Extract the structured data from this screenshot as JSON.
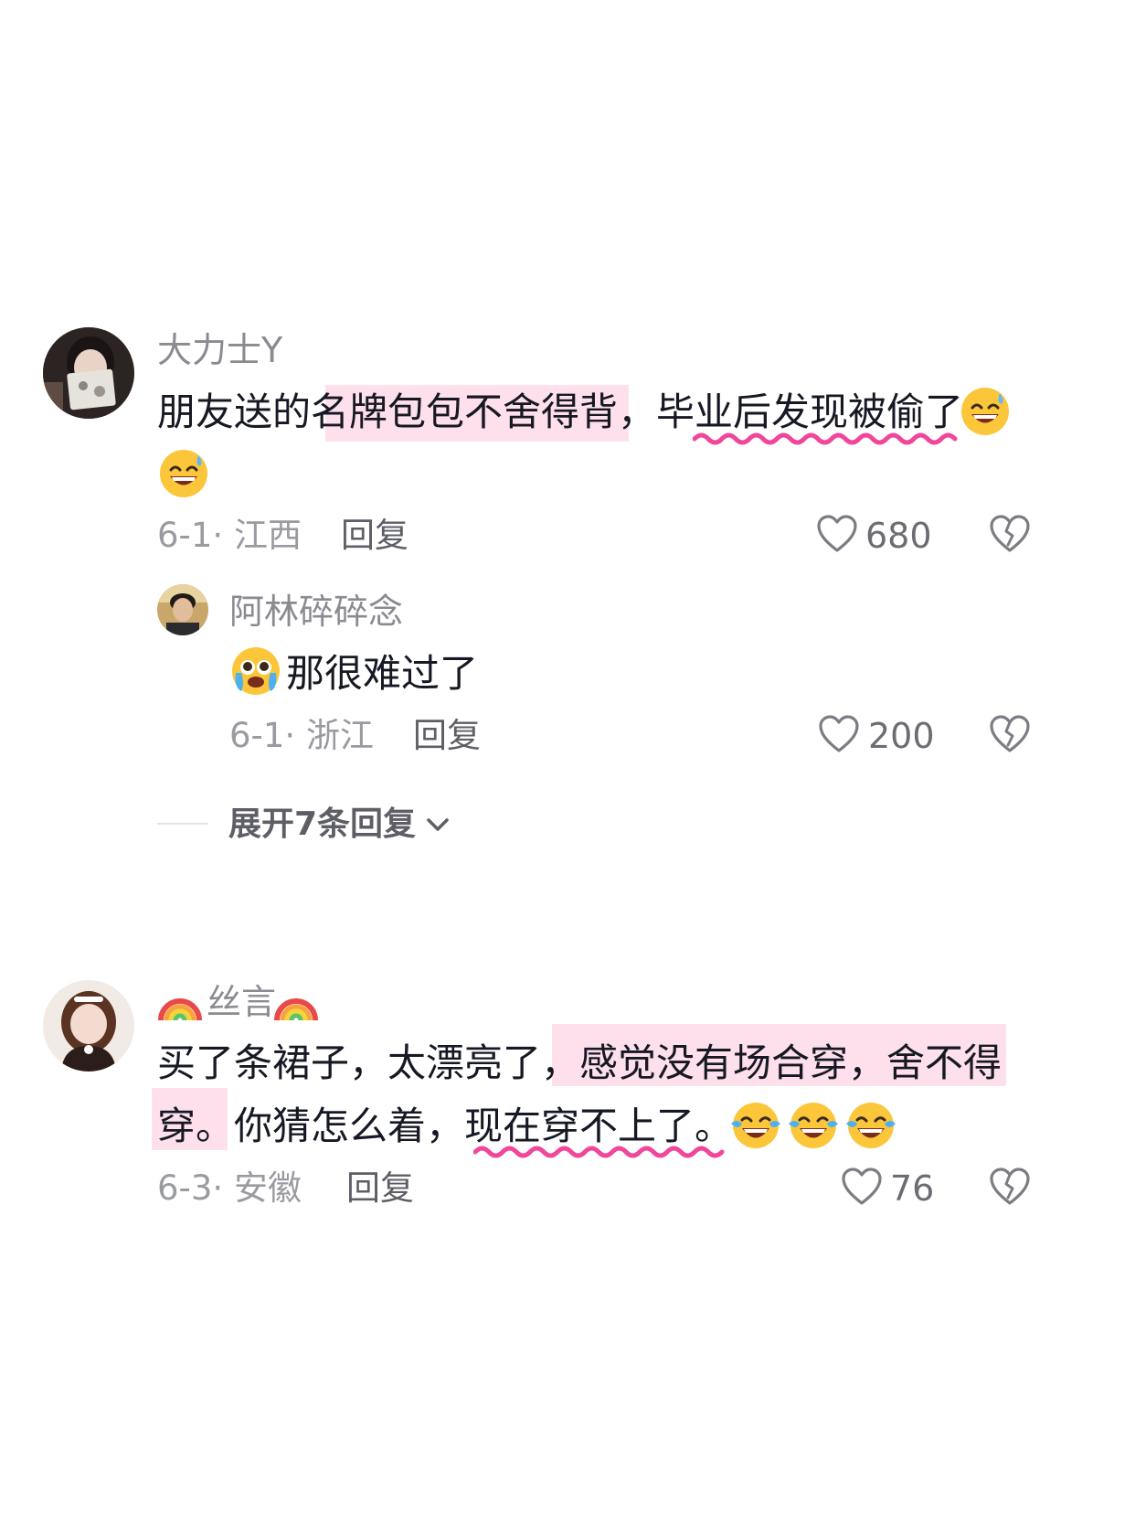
{
  "comments": [
    {
      "username": "大力士Y",
      "text_line1": "朋友送的名牌包包不舍得背，毕业后发现被偷了",
      "date_location": "6-1· 江西",
      "reply_label": "回复",
      "likes": "680",
      "emoji_line1": "grinning-sweat-emoji",
      "emoji_line2": "grinning-sweat-emoji",
      "replies": [
        {
          "username": "阿林碎碎念",
          "text": "那很难过了",
          "emoji": "pleading-crying-emoji",
          "date_location": "6-1· 浙江",
          "reply_label": "回复",
          "likes": "200"
        }
      ],
      "expand_label": "展开7条回复"
    },
    {
      "username": "丝言",
      "username_decoration": "rainbow-emoji",
      "text_line1": "买了条裙子，太漂亮了，感觉没有场合穿，舍不得",
      "text_line2": "穿。你猜怎么着，现在穿不上了。",
      "emoji_line2": "tears-of-joy-emoji",
      "date_location": "6-3· 安徽",
      "reply_label": "回复",
      "likes": "76"
    }
  ],
  "colors": {
    "highlight": "#fde0ec",
    "wavy_underline": "#f0479a",
    "meta_text": "#9a9ba1",
    "username_text": "#8a8b91"
  }
}
